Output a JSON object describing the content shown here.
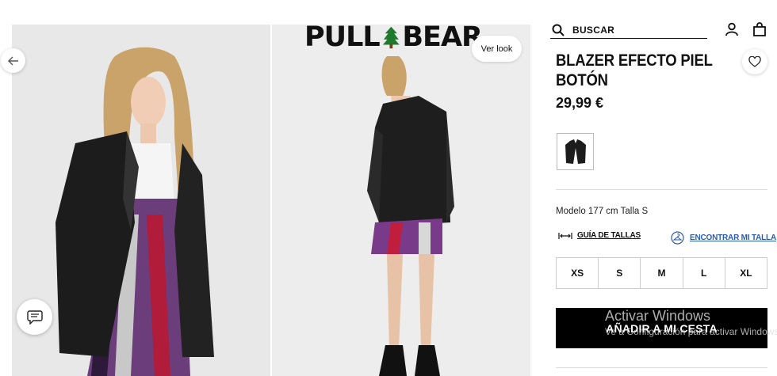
{
  "brand": {
    "logo_left": "PULL",
    "logo_right": "BEAR"
  },
  "header": {
    "menu_icon": "hamburger-icon"
  },
  "search": {
    "placeholder": "BUSCAR",
    "icon": "search-icon"
  },
  "account": {
    "user_icon": "user-icon",
    "bag_icon": "shopping-bag-icon"
  },
  "gallery": {
    "ver_look_label": "Ver look",
    "prev_icon": "arrow-left-icon",
    "chat_icon": "chat-icon"
  },
  "product": {
    "title": "BLAZER EFECTO PIEL BOTÓN",
    "price": "29,99 €",
    "model_info": "Modelo 177 cm Talla S",
    "size_guide_label": "GUÍA DE TALLAS",
    "find_size_label": "ENCONTRAR MI TALLA",
    "sizes": [
      "XS",
      "S",
      "M",
      "L",
      "XL"
    ],
    "add_to_cart_label": "AÑADIR A MI CESTA"
  },
  "overlay": {
    "activate_title": "Activar Windows",
    "activate_text": "Ve a Configuración para activar Windows."
  },
  "colors": {
    "accent_link": "#2a5db0",
    "button_bg": "#000000",
    "logo_tree": "#1e7a2c"
  }
}
